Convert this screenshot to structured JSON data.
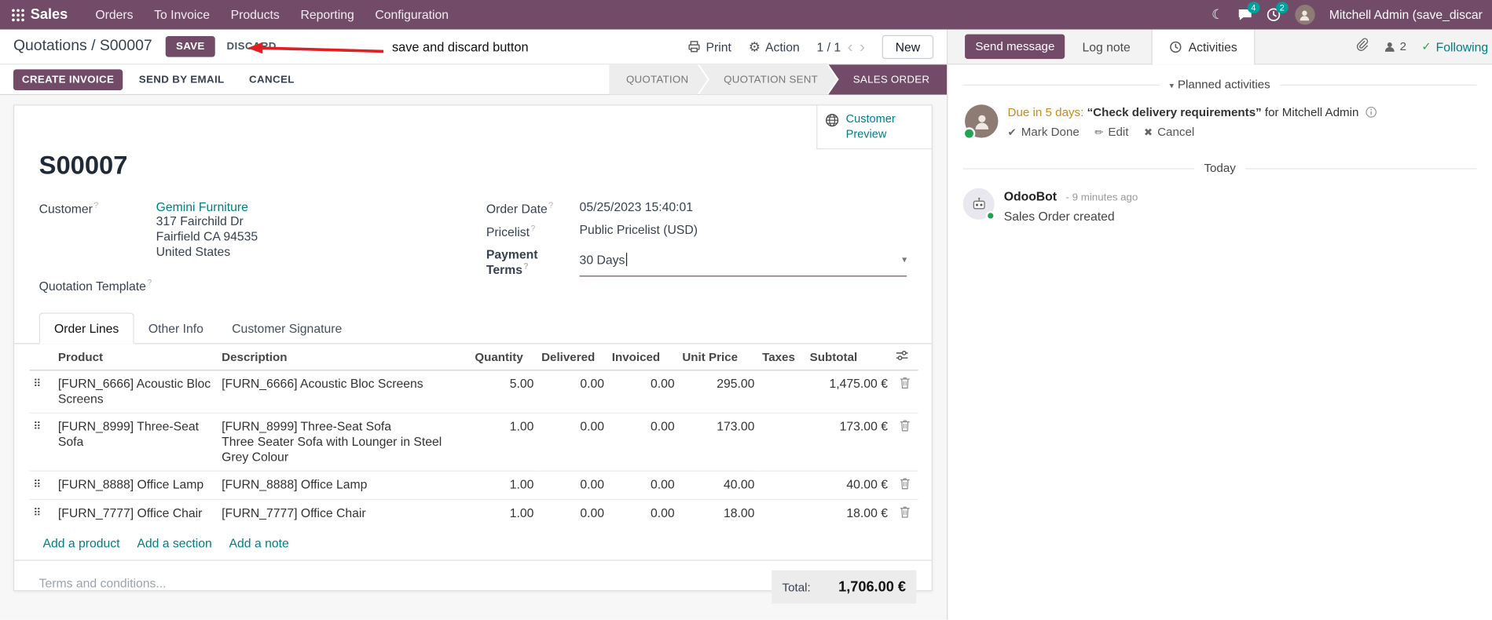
{
  "nav": {
    "brand": "Sales",
    "items": [
      "Orders",
      "To Invoice",
      "Products",
      "Reporting",
      "Configuration"
    ],
    "chat_badge": "4",
    "clock_badge": "2",
    "user_name": "Mitchell Admin (save_discar"
  },
  "control": {
    "breadcrumb_parent": "Quotations",
    "breadcrumb_sep": " / ",
    "breadcrumb_current": "S00007",
    "save": "SAVE",
    "discard": "DISCARD",
    "annotation": "save and discard button",
    "print": "Print",
    "action": "Action",
    "pager": "1 / 1",
    "new": "New"
  },
  "statusbar": {
    "create_invoice": "CREATE INVOICE",
    "send_by_email": "SEND BY EMAIL",
    "cancel": "CANCEL",
    "stages": [
      {
        "label": "QUOTATION"
      },
      {
        "label": "QUOTATION SENT"
      },
      {
        "label": "SALES ORDER"
      }
    ]
  },
  "sheet": {
    "customer_preview": "Customer Preview",
    "title": "S00007",
    "customer_label": "Customer",
    "customer_name": "Gemini Furniture",
    "address_line1": "317 Fairchild Dr",
    "address_line2": "Fairfield CA 94535",
    "address_line3": "United States",
    "quotation_template_label": "Quotation Template",
    "order_date_label": "Order Date",
    "order_date": "05/25/2023 15:40:01",
    "pricelist_label": "Pricelist",
    "pricelist": "Public Pricelist (USD)",
    "payment_terms_label": "Payment Terms",
    "payment_terms": "30 Days",
    "tabs": [
      {
        "label": "Order Lines"
      },
      {
        "label": "Other Info"
      },
      {
        "label": "Customer Signature"
      }
    ],
    "table": {
      "headers": {
        "product": "Product",
        "description": "Description",
        "quantity": "Quantity",
        "delivered": "Delivered",
        "invoiced": "Invoiced",
        "unit_price": "Unit Price",
        "taxes": "Taxes",
        "subtotal": "Subtotal"
      },
      "rows": [
        {
          "product": "[FURN_6666] Acoustic Bloc Screens",
          "description": "[FURN_6666] Acoustic Bloc Screens",
          "quantity": "5.00",
          "delivered": "0.00",
          "invoiced": "0.00",
          "unit_price": "295.00",
          "taxes": "",
          "subtotal": "1,475.00 €"
        },
        {
          "product": "[FURN_8999] Three-Seat Sofa",
          "description": "[FURN_8999] Three-Seat Sofa",
          "description2": "Three Seater Sofa with Lounger in Steel Grey Colour",
          "quantity": "1.00",
          "delivered": "0.00",
          "invoiced": "0.00",
          "unit_price": "173.00",
          "taxes": "",
          "subtotal": "173.00 €"
        },
        {
          "product": "[FURN_8888] Office Lamp",
          "description": "[FURN_8888] Office Lamp",
          "quantity": "1.00",
          "delivered": "0.00",
          "invoiced": "0.00",
          "unit_price": "40.00",
          "taxes": "",
          "subtotal": "40.00 €"
        },
        {
          "product": "[FURN_7777] Office Chair",
          "description": "[FURN_7777] Office Chair",
          "quantity": "1.00",
          "delivered": "0.00",
          "invoiced": "0.00",
          "unit_price": "18.00",
          "taxes": "",
          "subtotal": "18.00 €"
        }
      ]
    },
    "add_product": "Add a product",
    "add_section": "Add a section",
    "add_note": "Add a note",
    "terms_placeholder": "Terms and conditions...",
    "total_label": "Total:",
    "total_value": "1,706.00 €"
  },
  "chatter": {
    "send_message": "Send message",
    "log_note": "Log note",
    "activities": "Activities",
    "followers_count": "2",
    "following": "Following",
    "planned_header": "Planned activities",
    "activity": {
      "due": "Due in 5 days:",
      "summary": "“Check delivery requirements”",
      "assignee": "for Mitchell Admin",
      "mark_done": "Mark Done",
      "edit": "Edit",
      "cancel": "Cancel"
    },
    "today": "Today",
    "message": {
      "author": "OdooBot",
      "time": "- 9 minutes ago",
      "body": "Sales Order created"
    }
  },
  "icons": {
    "moon": "☾",
    "gear": "⚙",
    "chevron_left": "‹",
    "chevron_right": "›",
    "caret_down": "▾",
    "chevron_collapse": "▾",
    "drag_handle": "⠿",
    "check": "✔",
    "check_small": "✓",
    "pencil": "✏",
    "x": "✖",
    "help": "?"
  },
  "colors": {
    "primary": "#714B67",
    "link": "#017E84",
    "badge": "#00A09D",
    "stage_active": "#714B67",
    "due_warning": "#c98a1b",
    "annotation_red": "#e02020",
    "following_check": "#28a745"
  }
}
